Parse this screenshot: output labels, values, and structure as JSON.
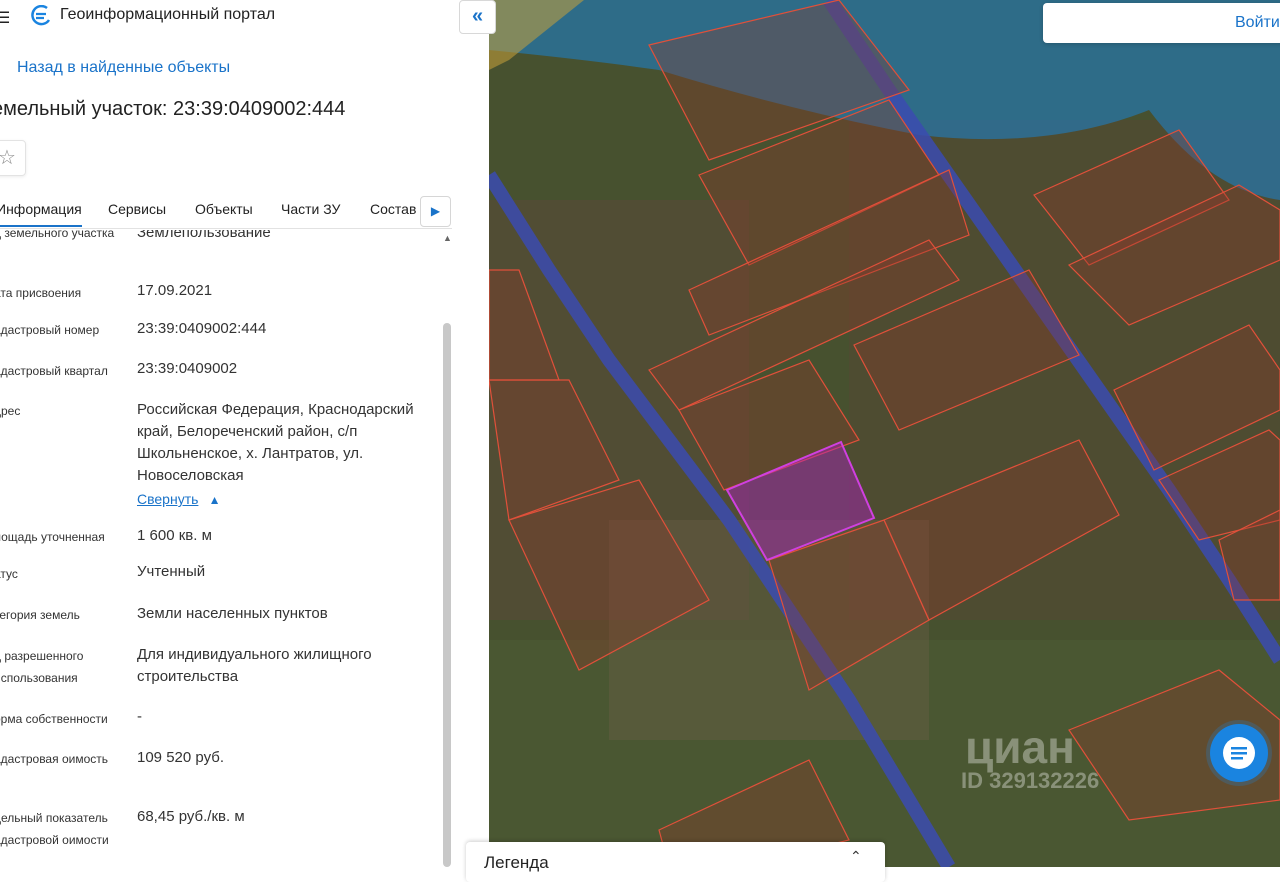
{
  "header": {
    "brand": "Геоинформационный портал",
    "menu_icon": "menu-icon",
    "logo_icon": "portal-logo"
  },
  "nav": {
    "back_label": "Назад в найденные объекты"
  },
  "object": {
    "title": "емельный участок: 23:39:0409002:444"
  },
  "tabs": [
    "Информация",
    "Сервисы",
    "Объекты",
    "Части ЗУ",
    "Состав"
  ],
  "rows": {
    "r0": {
      "label": "д земельного участка",
      "value": "Землепользование"
    },
    "r1": {
      "label": "ата присвоения",
      "value": "17.09.2021"
    },
    "r2": {
      "label": "адастровый номер",
      "value": "23:39:0409002:444"
    },
    "r3": {
      "label": "адастровый квартал",
      "value": "23:39:0409002"
    },
    "r4": {
      "label": "дрес",
      "value": "Российская Федерация, Краснодарский край, Белореченский район, с/п Школьненское, х. Лантратов, ул. Новоселовская",
      "collapse": "Свернуть"
    },
    "r5": {
      "label": "лощадь уточненная",
      "value": "1 600 кв. м"
    },
    "r6": {
      "label": "атус",
      "value": "Учтенный"
    },
    "r7": {
      "label": "тегория земель",
      "value": "Земли населенных пунктов"
    },
    "r8": {
      "label": "д разрешенного использования",
      "value": "Для индивидуального жилищного строительства"
    },
    "r9": {
      "label": "орма собственности",
      "value": "-"
    },
    "r10": {
      "label": "адастровая оимость",
      "value": "109 520 руб."
    },
    "r11": {
      "label": "дельный показатель адастровой оимости",
      "value": "68,45 руб./кв. м"
    }
  },
  "map": {
    "login_label": "Войти",
    "legend_label": "Легенда",
    "watermark": "циан",
    "watermark_id": "ID 329132226",
    "parcel_color": "#e0503a",
    "selected_color": "#c02bc8",
    "water_color": "#1e7fc4",
    "road_color": "#3b4bb0"
  }
}
